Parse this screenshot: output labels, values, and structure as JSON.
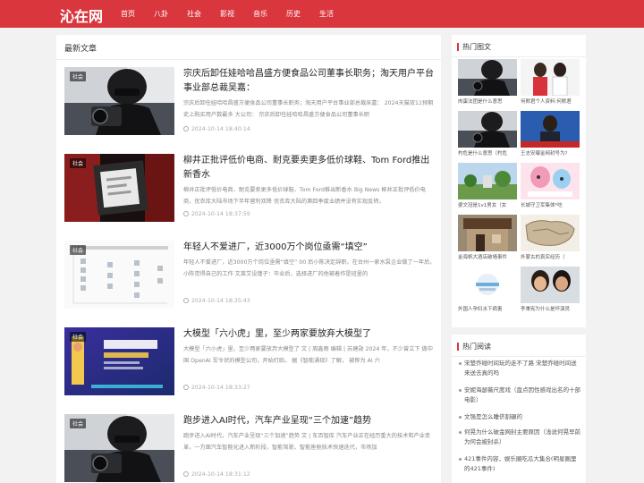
{
  "header": {
    "logo": "沁在网",
    "nav": [
      "首页",
      "八卦",
      "社会",
      "影视",
      "音乐",
      "历史",
      "生活"
    ]
  },
  "main": {
    "section_title": "最新文章",
    "articles": [
      {
        "tag": "社会",
        "title": "宗庆后卸任娃哈哈昌盛方便食品公司董事长职务；淘天用户平台事业部总裁吴嘉：",
        "desc": "宗庆后卸任娃哈哈昌盛方便食品公司董事长职务；淘天用户平台事业部总裁吴嘉： 2024天猫双11预期史上购买用户数最多 大公司： 宗庆后卸任娃哈哈昌盛方便食品公司董事长职",
        "time": "2024-10-14 18:40:14"
      },
      {
        "tag": "社会",
        "title": "柳井正批评低价电商、耐克要卖更多低价球鞋、Tom Ford推出新香水",
        "desc": "柳井正批评低价电商、耐克要卖更多低价球鞋、Tom Ford推出新香水 Big News 柳井正批评低价电商，优衣库大陆市场下半年营利双降 优衣库大陆的第四季度业绩并没有实现反转。",
        "time": "2024-10-14 18:37:59"
      },
      {
        "tag": "社会",
        "title": "年轻人不爱进厂，近3000万个岗位亟需“填空”",
        "desc": "年轻人不爱进厂，近3000万个岗位亟需“填空” 00 后小陈决定辞职。在台州一家水泵企业做了一年后，小陈觉得自己的工作 文莱艾设蓮子：毕业后，选择进厂的他被着作是班里的",
        "time": "2024-10-14 18:35:43"
      },
      {
        "tag": "社会",
        "title": "大模型「六小虎」里，至少两家要放弃大模型了",
        "desc": "大模型「六小虎」里，至少两家要放弃大模型了 文 | 周鑫雨 编辑 | 苏建勋 2024 年，不少曾立下 做中国 OpenAI 军令状的模型公司，开始打脸。 据《智能涌现》了解， 被称为 AI 六",
        "time": "2024-10-14 18:33:27"
      },
      {
        "tag": "社会",
        "title": "跑步进入AI时代，汽车产业呈现“三个加速”趋势",
        "desc": "跑步进入AI时代，汽车产业呈现“三个加速”趋势 文 | 车百智库 汽车产业正在经历重大的技术和产业变革，一方面汽车智能化进入新阶段，智能驾驶、智能座舱技术快速迭代，市场加",
        "time": "2024-10-14 18:31:12"
      }
    ]
  },
  "sidebar": {
    "pics_title": "热门图文",
    "pics": [
      "肉蛋法团是什么意思",
      "何默君个人资料:何默君",
      "杓危是什么意思（杓危",
      "王志安曝金网封号为?",
      "婆文冠是1v1男女（女",
      "长城守卫军集体*吃",
      "金海帆大酒店破墙事件",
      "外蒙古的真实经历（",
      "外国人孕妇水下病害",
      "李秉宪为什么是坏演员"
    ],
    "read_title": "热门阅读",
    "reads": [
      "宋楚乔碰时间玩的走不了路 宋楚乔碰时间送来送去真的吗",
      "安妮海瑟薇尺度戏（盘点因性感戏出名的十部电影）",
      "文强是怎么睡侪割碾的",
      "何晃为什么破金网封主要原因（浅说何晃早前为何会被封杀）",
      "421事件内容，娱乐圈吃瓜大集合(明星圈里的421事件)"
    ]
  }
}
